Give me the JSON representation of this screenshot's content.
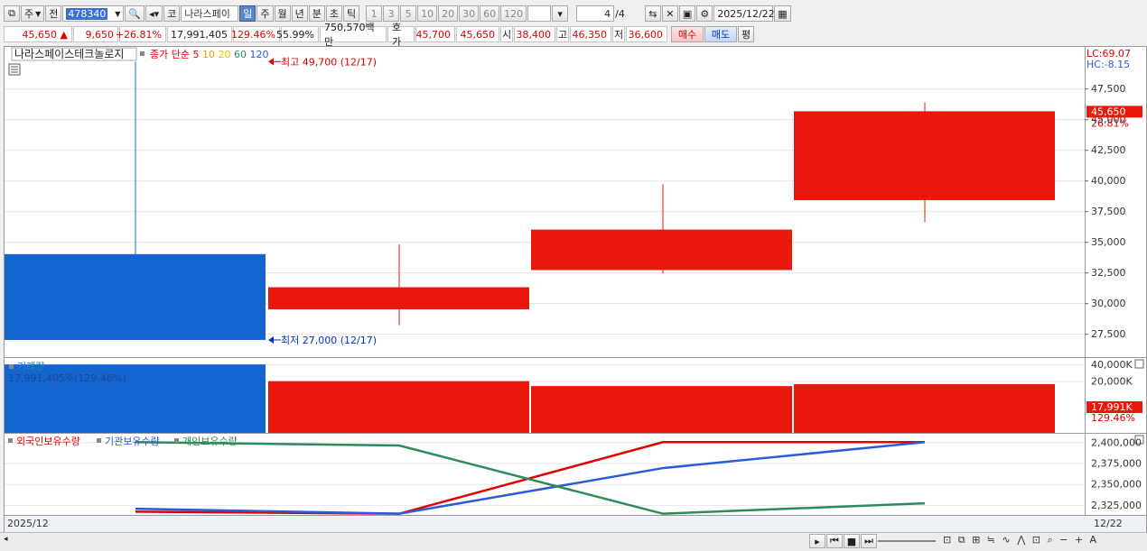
{
  "toolbar1": {
    "period_combo": "주",
    "prev_label": "전",
    "code": "478340",
    "type_btn": "코",
    "stock_name": "나라스페이",
    "period_tabs": [
      "일",
      "주",
      "월",
      "년",
      "분",
      "초",
      "틱"
    ],
    "active_tab": "일",
    "intervals": [
      "1",
      "3",
      "5",
      "10",
      "20",
      "30",
      "60",
      "120"
    ],
    "page": "4",
    "page_total": "/4",
    "date": "2025/12/22"
  },
  "toolbar2": {
    "price": "45,650",
    "change_arrow": "▲",
    "change": "9,650",
    "change_pct": "+26.81%",
    "volume": "17,991,405",
    "vol_ratio": "129.46%",
    "turnover": "55.99%",
    "amount": "750,570백만",
    "quote_label": "호가",
    "ask": "45,700",
    "bid": "45,650",
    "open_label": "시",
    "open": "38,400",
    "high_label": "고",
    "high": "46,350",
    "low_label": "저",
    "low": "36,600",
    "buy_label": "매수",
    "sell_label": "매도",
    "eval_label": "평"
  },
  "colors": {
    "up": "#e8180c",
    "down": "#1565d0",
    "foreign": "#e00000",
    "inst": "#2a5bd7",
    "indiv": "#2e8b57"
  },
  "chart_data": [
    {
      "type": "candlestick",
      "title": "나라스페이스테크놀로지",
      "legend": {
        "label": "종가 단순",
        "mas": [
          {
            "name": "5",
            "color": "#e00000"
          },
          {
            "name": "10",
            "color": "#e8a000"
          },
          {
            "name": "20",
            "color": "#e0c000"
          },
          {
            "name": "60",
            "color": "#2e8b57"
          },
          {
            "name": "120",
            "color": "#2a5bd7"
          }
        ]
      },
      "top_right": {
        "lc": "LC:69.07",
        "hc": "HC:-8.15"
      },
      "candles": [
        {
          "open": 34000,
          "close": 27000,
          "high": 49700,
          "low": 27000
        },
        {
          "open": 29500,
          "close": 31300,
          "high": 34800,
          "low": 28200
        },
        {
          "open": 32700,
          "close": 36000,
          "high": 39700,
          "low": 32400
        },
        {
          "open": 38400,
          "close": 45650,
          "high": 46350,
          "low": 36600
        }
      ],
      "ylim": [
        25600,
        50900
      ],
      "yticks": [
        {
          "v": 47500,
          "l": "47,500"
        },
        {
          "v": 45000,
          "l": "45,000"
        },
        {
          "v": 42500,
          "l": "42,500"
        },
        {
          "v": 40000,
          "l": "40,000"
        },
        {
          "v": 37500,
          "l": "37,500"
        },
        {
          "v": 35000,
          "l": "35,000"
        },
        {
          "v": 32500,
          "l": "32,500"
        },
        {
          "v": 30000,
          "l": "30,000"
        },
        {
          "v": 27500,
          "l": "27,500"
        }
      ],
      "max_marker": {
        "label": "최고 49,700 (12/17)",
        "value": 49700
      },
      "min_marker": {
        "label": "최저 27,000 (12/17)",
        "value": 27000
      },
      "last_tag": {
        "price": "45,650",
        "pct": "26.81%",
        "value": 45650
      }
    },
    {
      "type": "bar",
      "title": "거래량",
      "subtitle": "17,991,405주(129.46%)",
      "values": [
        13900000,
        10500000,
        9500000,
        9900000
      ],
      "ylim": [
        0,
        15200000
      ],
      "yticks": [
        {
          "v": 13900000,
          "l": "40,000K"
        },
        {
          "v": 10500000,
          "l": "20,000K"
        }
      ],
      "last_tag": {
        "value": "17,991K",
        "pct": "129.46%"
      }
    },
    {
      "type": "line",
      "series": [
        {
          "name": "외국인보유수량",
          "color_key": "foreign",
          "values": [
            2317000,
            2314500,
            2400000,
            2400000
          ]
        },
        {
          "name": "기관보유수량",
          "color_key": "inst",
          "values": [
            2320500,
            2314500,
            2369000,
            2400000
          ]
        },
        {
          "name": "개인보유수량",
          "color_key": "indiv",
          "values": [
            2400000,
            2396000,
            2314500,
            2327000
          ]
        }
      ],
      "ylim": [
        2312000,
        2410000
      ],
      "yticks": [
        {
          "v": 2400000,
          "l": "2,400,000"
        },
        {
          "v": 2375000,
          "l": "2,375,000"
        },
        {
          "v": 2350000,
          "l": "2,350,000"
        },
        {
          "v": 2325000,
          "l": "2,325,000"
        }
      ]
    }
  ],
  "xaxis": {
    "left_label": "2025/12",
    "right_label": "12/22"
  }
}
